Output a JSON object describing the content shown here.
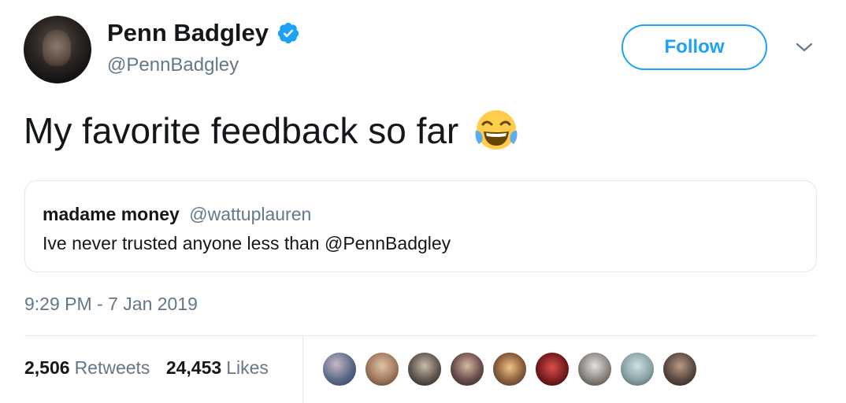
{
  "author": {
    "name": "Penn Badgley",
    "handle": "@PennBadgley",
    "verified": true,
    "verified_icon": "verified-badge-icon"
  },
  "follow_label": "Follow",
  "menu_icon": "chevron-down-icon",
  "tweet": {
    "text": "My favorite feedback so far",
    "emoji": "face-with-tears-of-joy-icon"
  },
  "quote": {
    "name": "madame money",
    "handle": "@wattuplauren",
    "text": "Ive never trusted anyone less than @PennBadgley"
  },
  "timestamp": "9:29 PM - 7 Jan 2019",
  "stats": {
    "retweets_count": "2,506",
    "retweets_label": "Retweets",
    "likes_count": "24,453",
    "likes_label": "Likes"
  },
  "colors": {
    "accent": "#1da1f2",
    "secondary_text": "#657786",
    "primary_text": "#14171a",
    "border": "#e1e8ed"
  }
}
